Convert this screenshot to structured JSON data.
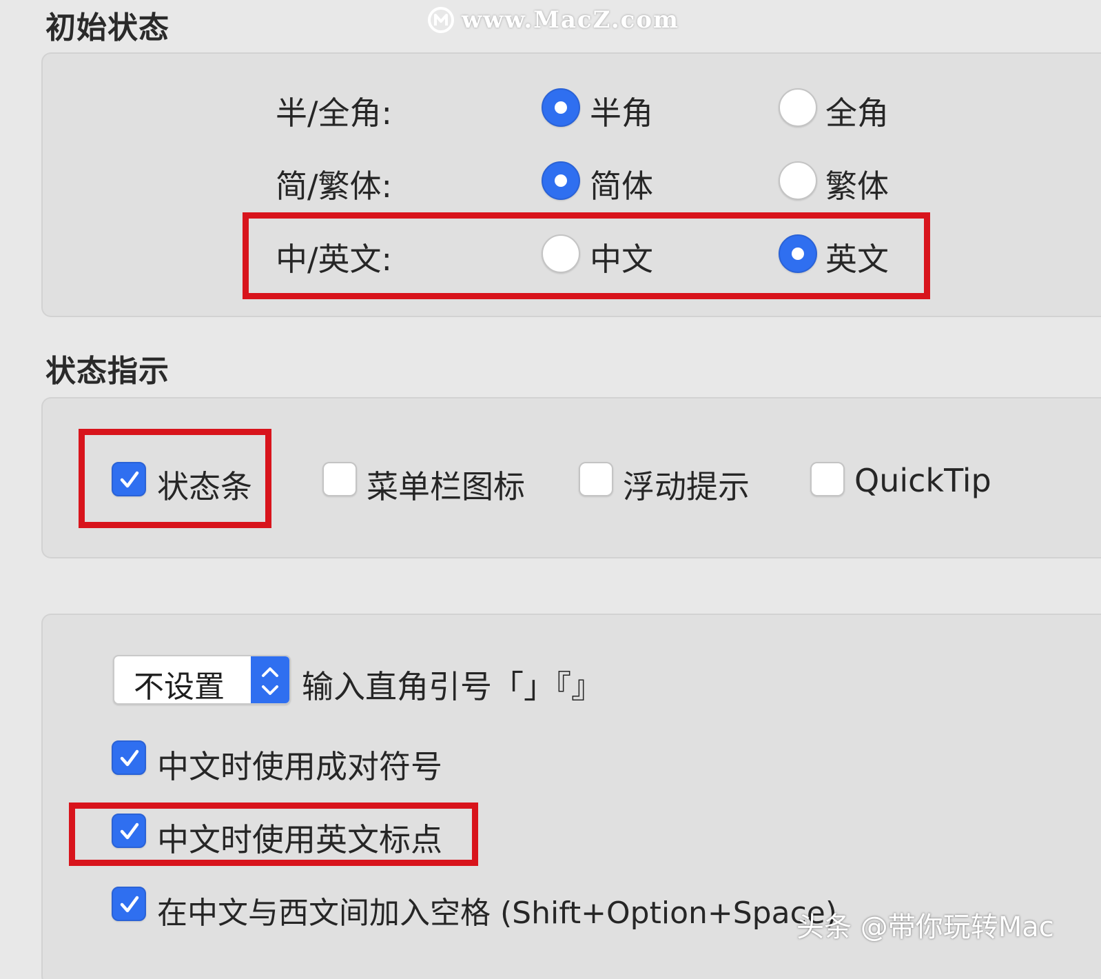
{
  "watermark_top": "www.MacZ.com",
  "watermark_bottom": "头条 @带你玩转Mac",
  "initial_state": {
    "title": "初始状态",
    "rows": [
      {
        "label": "半/全角:",
        "options": [
          "半角",
          "全角"
        ],
        "selected": 0
      },
      {
        "label": "简/繁体:",
        "options": [
          "简体",
          "繁体"
        ],
        "selected": 0
      },
      {
        "label": "中/英文:",
        "options": [
          "中文",
          "英文"
        ],
        "selected": 1
      }
    ]
  },
  "status_indicator": {
    "title": "状态指示",
    "items": [
      {
        "label": "状态条",
        "checked": true
      },
      {
        "label": "菜单栏图标",
        "checked": false
      },
      {
        "label": "浮动提示",
        "checked": false
      },
      {
        "label": "QuickTip",
        "checked": false
      }
    ]
  },
  "punctuation": {
    "quote_select_value": "不设置",
    "quote_select_label": "输入直角引号「」『』",
    "options": [
      {
        "label": "中文时使用成对符号",
        "checked": true
      },
      {
        "label": "中文时使用英文标点",
        "checked": true
      },
      {
        "label": "在中文与西文间加入空格 (Shift+Option+Space)",
        "checked": true
      }
    ]
  },
  "colors": {
    "accent": "#2f6ff0",
    "highlight": "#d8141c",
    "background": "#e8e8e8",
    "panel": "#e0e0e0"
  }
}
